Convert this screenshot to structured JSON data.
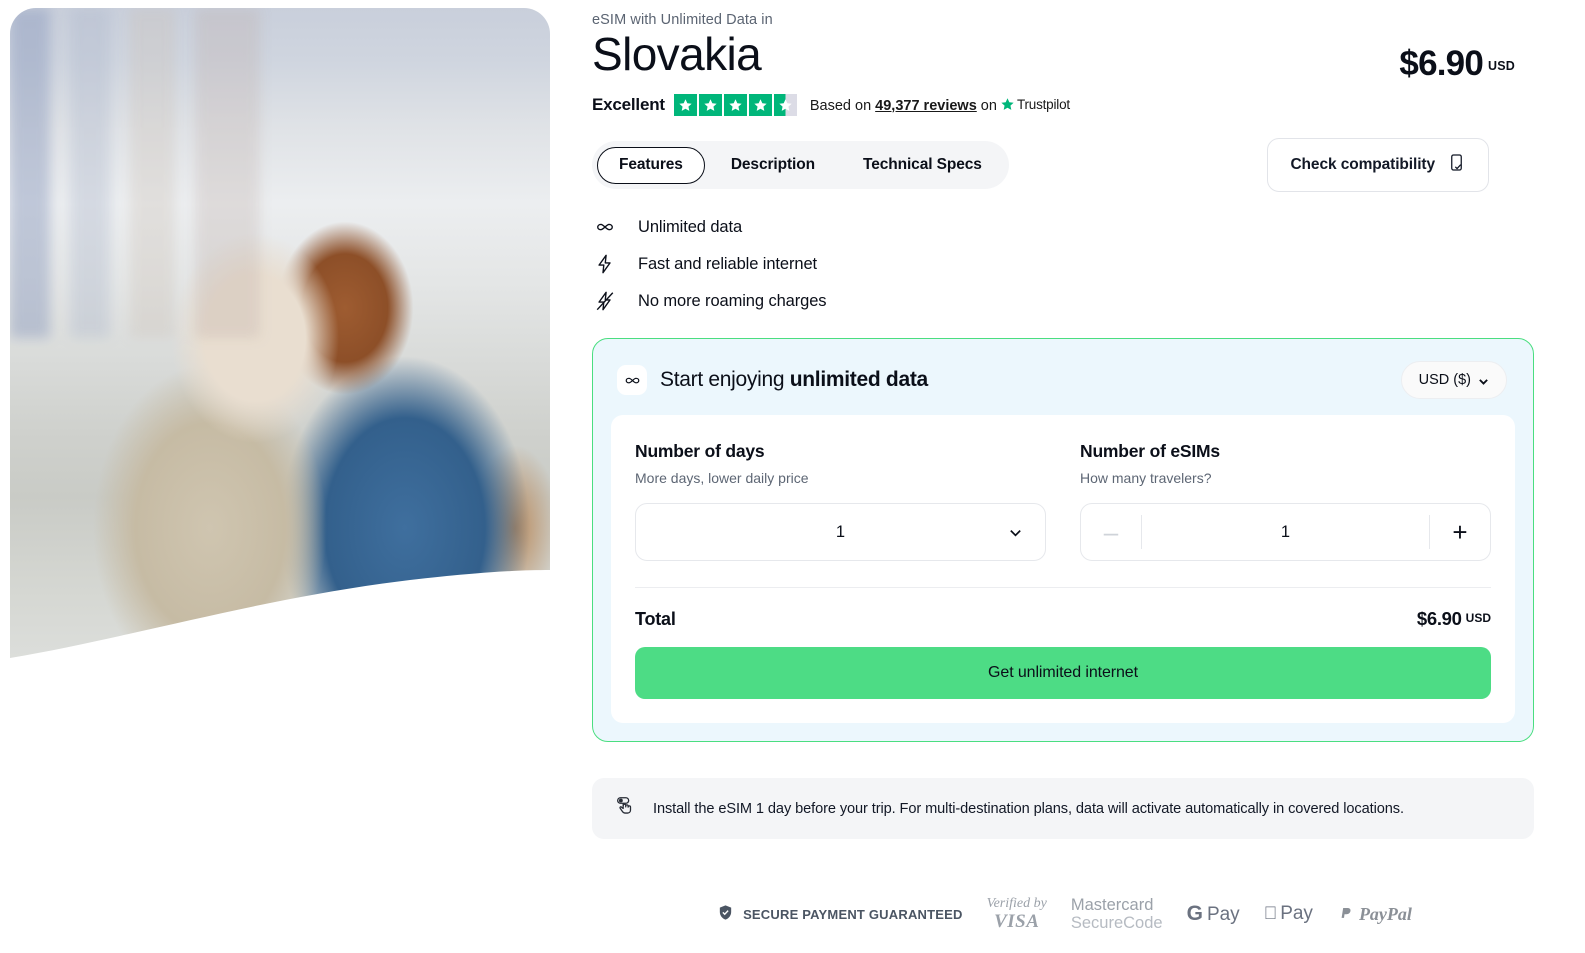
{
  "hero": {
    "alt": "Senior couple looking at a phone and map on a cobblestone street"
  },
  "header": {
    "eyebrow": "eSIM with Unlimited Data in",
    "title": "Slovakia",
    "price": "$6.90",
    "price_currency": "USD"
  },
  "trustpilot": {
    "rating_word": "Excellent",
    "stars": 4.5,
    "based_on_prefix": "Based on",
    "reviews_count": "49,377 reviews",
    "on_word": "on",
    "brand": "Trustpilot",
    "star_color": "#00b67a"
  },
  "tabs": [
    {
      "label": "Features",
      "active": true
    },
    {
      "label": "Description",
      "active": false
    },
    {
      "label": "Technical Specs",
      "active": false
    }
  ],
  "compatibility": {
    "label": "Check compatibility",
    "icon": "phone-check-icon"
  },
  "features": [
    {
      "icon": "infinity-icon",
      "label": "Unlimited data"
    },
    {
      "icon": "bolt-icon",
      "label": "Fast and reliable internet"
    },
    {
      "icon": "bolt-slash-icon",
      "label": "No more roaming charges"
    }
  ],
  "offer": {
    "heading_normal": "Start enjoying ",
    "heading_bold": "unlimited data",
    "icon": "infinity-icon",
    "currency_selected": "USD ($)",
    "days": {
      "label": "Number of days",
      "sublabel": "More days, lower daily price",
      "value": "1"
    },
    "esims": {
      "label": "Number of eSIMs",
      "sublabel": "How many travelers?",
      "value": "1",
      "decrement": "–",
      "increment": "+",
      "decrement_disabled": true
    },
    "total_label": "Total",
    "total_amount": "$6.90",
    "total_currency": "USD",
    "cta_label": "Get unlimited internet",
    "border_color": "#4ade80",
    "background_color": "#ecf7fd",
    "cta_color": "#4ddc85"
  },
  "notice": {
    "icon": "tap-hand-icon",
    "text": "Install the eSIM 1 day before your trip. For multi-destination plans, data will activate automatically in covered locations."
  },
  "payments": {
    "secure_label": "SECURE PAYMENT GUARANTEED",
    "secure_icon": "shield-check-icon",
    "visa_line1": "Verified by",
    "visa_line2": "VISA",
    "mastercard_line1": "Mastercard",
    "mastercard_line2": "SecureCode",
    "gpay_g": "G",
    "gpay_pay": "Pay",
    "applepay_logo": "",
    "applepay_pay": "Pay",
    "paypal": "PayPal"
  }
}
